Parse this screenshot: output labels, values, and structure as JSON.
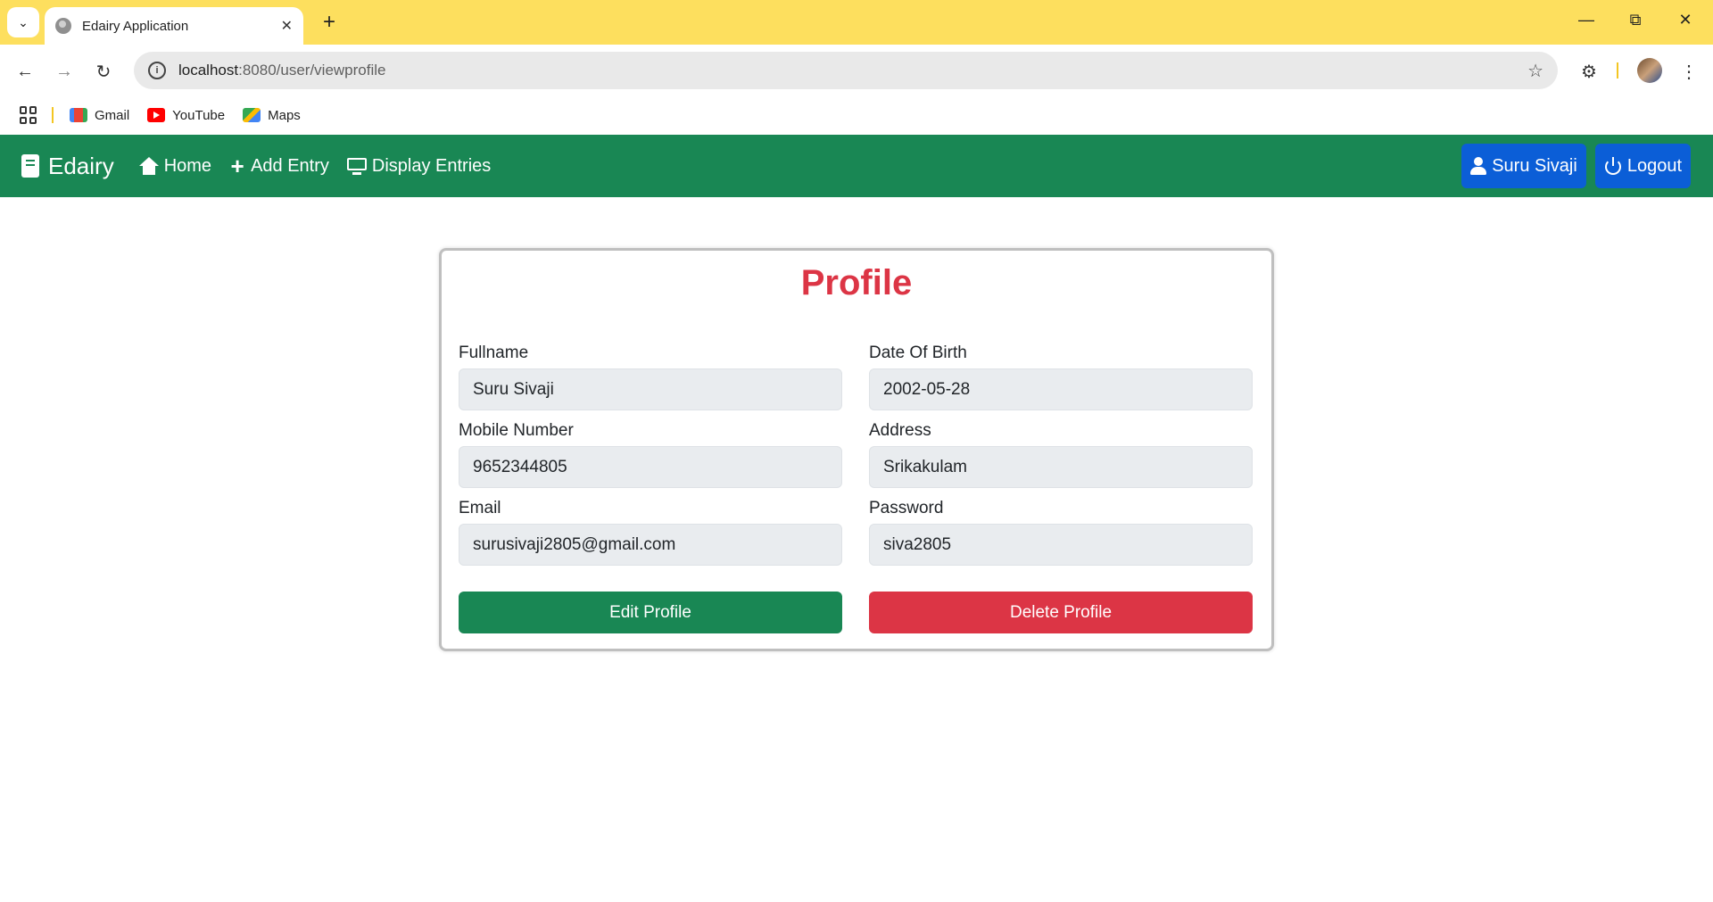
{
  "browser": {
    "tab_title": "Edairy Application",
    "url_host": "localhost",
    "url_rest": ":8080/user/viewprofile",
    "bookmarks": [
      {
        "label": "Gmail",
        "icon": "gmail-icon"
      },
      {
        "label": "YouTube",
        "icon": "youtube-icon"
      },
      {
        "label": "Maps",
        "icon": "maps-icon"
      }
    ]
  },
  "navbar": {
    "brand": "Edairy",
    "links": [
      {
        "label": "Home",
        "icon": "home-icon"
      },
      {
        "label": "Add Entry",
        "icon": "plus-icon"
      },
      {
        "label": "Display Entries",
        "icon": "monitor-icon"
      }
    ],
    "user_button": "Suru Sivaji",
    "logout_button": "Logout",
    "colors": {
      "bar": "#198754",
      "button": "#0b5ed7"
    }
  },
  "profile": {
    "title": "Profile",
    "fields": {
      "fullname": {
        "label": "Fullname",
        "value": "Suru Sivaji"
      },
      "dob": {
        "label": "Date Of Birth",
        "value": "2002-05-28"
      },
      "mobile": {
        "label": "Mobile Number",
        "value": "9652344805"
      },
      "address": {
        "label": "Address",
        "value": "Srikakulam"
      },
      "email": {
        "label": "Email",
        "value": "surusivaji2805@gmail.com"
      },
      "password": {
        "label": "Password",
        "value": "siva2805"
      }
    },
    "edit_button": "Edit Profile",
    "delete_button": "Delete Profile",
    "colors": {
      "title": "#dc3545",
      "edit": "#198754",
      "delete": "#dc3545"
    }
  }
}
